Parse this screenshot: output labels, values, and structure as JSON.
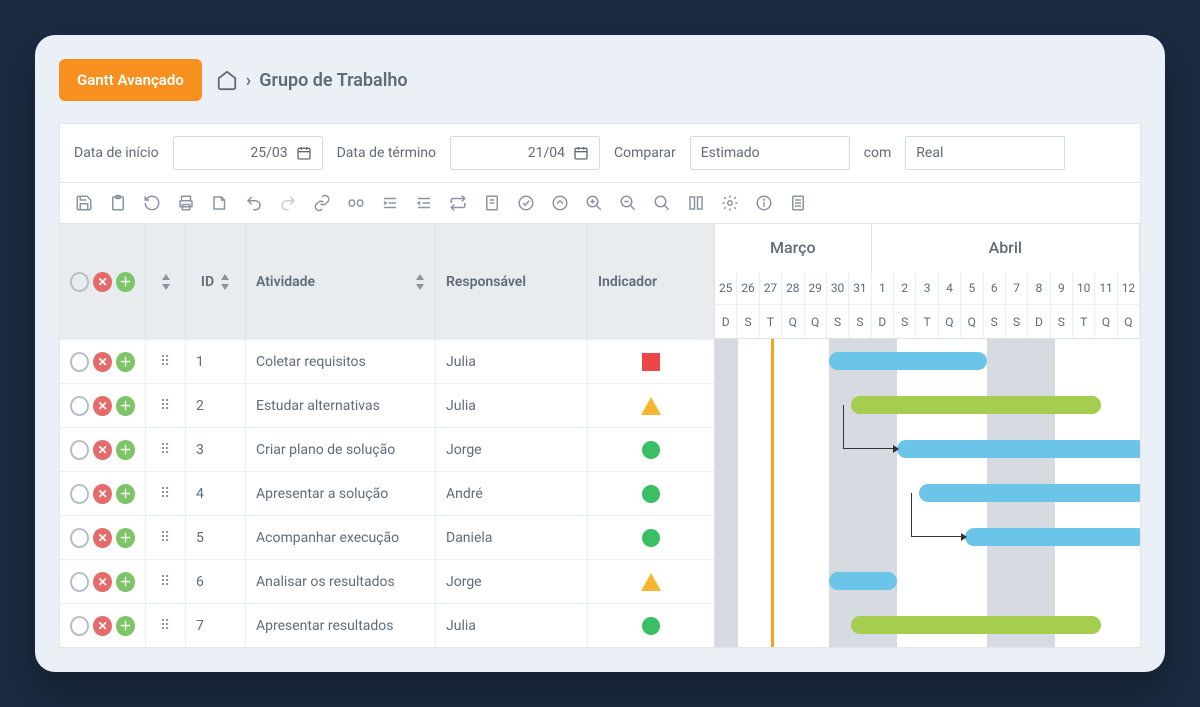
{
  "header": {
    "badge": "Gantt Avançado",
    "breadcrumb": "Grupo de Trabalho"
  },
  "filters": {
    "start_label": "Data de início",
    "start_value": "25/03",
    "end_label": "Data de término",
    "end_value": "21/04",
    "compare_label": "Comparar",
    "compare_value": "Estimado",
    "with_label": "com",
    "with_value": "Real"
  },
  "columns": {
    "id": "ID",
    "activity": "Atividade",
    "responsible": "Responsável",
    "indicator": "Indicador"
  },
  "rows": [
    {
      "id": "1",
      "activity": "Coletar requisitos",
      "responsible": "Julia",
      "indicator": "square"
    },
    {
      "id": "2",
      "activity": "Estudar alternativas",
      "responsible": "Julia",
      "indicator": "triangle"
    },
    {
      "id": "3",
      "activity": "Criar plano de solução",
      "responsible": "Jorge",
      "indicator": "circle"
    },
    {
      "id": "4",
      "activity": "Apresentar a solução",
      "responsible": "André",
      "indicator": "circle"
    },
    {
      "id": "5",
      "activity": "Acompanhar execução",
      "responsible": "Daniela",
      "indicator": "circle"
    },
    {
      "id": "6",
      "activity": "Analisar os resultados",
      "responsible": "Jorge",
      "indicator": "triangle"
    },
    {
      "id": "7",
      "activity": "Apresentar resultados",
      "responsible": "Julia",
      "indicator": "circle"
    }
  ],
  "timeline": {
    "months": [
      {
        "name": "Março",
        "days": 7
      },
      {
        "name": "Abril",
        "days": 12
      }
    ],
    "days": [
      "25",
      "26",
      "27",
      "28",
      "29",
      "30",
      "31",
      "1",
      "2",
      "3",
      "4",
      "5",
      "6",
      "7",
      "8",
      "9",
      "10",
      "11",
      "12"
    ],
    "dow": [
      "D",
      "S",
      "T",
      "Q",
      "Q",
      "S",
      "S",
      "D",
      "S",
      "T",
      "Q",
      "Q",
      "S",
      "S",
      "D",
      "S",
      "T",
      "Q",
      "Q"
    ],
    "weekend_idx": [
      0,
      5,
      6,
      7,
      12,
      13,
      14
    ],
    "today_idx": 2
  },
  "chart_data": {
    "type": "gantt",
    "date_range": {
      "start": "25/03",
      "end": "12/04"
    },
    "bars": [
      {
        "row": 0,
        "start_idx": 5,
        "span": 7,
        "color": "blue",
        "task": "Coletar requisitos"
      },
      {
        "row": 1,
        "start_idx": 6,
        "span": 11,
        "color": "green",
        "task": "Estudar alternativas"
      },
      {
        "row": 2,
        "start_idx": 8,
        "span": 11,
        "color": "blue",
        "task": "Criar plano de solução"
      },
      {
        "row": 3,
        "start_idx": 9,
        "span": 10,
        "color": "blue",
        "task": "Apresentar a solução"
      },
      {
        "row": 4,
        "start_idx": 11,
        "span": 8,
        "color": "blue",
        "task": "Acompanhar execução"
      },
      {
        "row": 5,
        "start_idx": 5,
        "span": 3,
        "color": "blue",
        "task": "Analisar os resultados"
      },
      {
        "row": 6,
        "start_idx": 6,
        "span": 11,
        "color": "green",
        "task": "Apresentar resultados"
      }
    ],
    "dependencies": [
      {
        "from_row": 1,
        "to_row": 2
      },
      {
        "from_row": 3,
        "to_row": 4
      }
    ]
  }
}
